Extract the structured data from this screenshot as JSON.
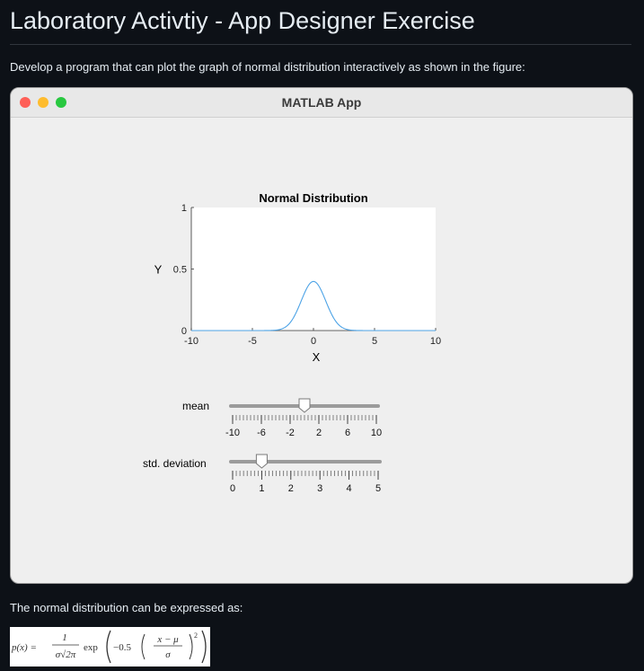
{
  "page": {
    "title": "Laboratory Activtiy - App Designer Exercise",
    "intro": "Develop a program that can plot the graph of normal distribution interactively as shown in the figure:",
    "formula_intro": "The normal distribution can be expressed as:"
  },
  "app": {
    "window_title": "MATLAB App",
    "colors": {
      "close": "#fe5f57",
      "minimize": "#febc2e",
      "maximize": "#28c840"
    }
  },
  "chart_data": {
    "type": "line",
    "title": "Normal Distribution",
    "xlabel": "X",
    "ylabel": "Y",
    "xlim": [
      -10,
      10
    ],
    "ylim": [
      0,
      1
    ],
    "x_ticks": [
      "-10",
      "-5",
      "0",
      "5",
      "10"
    ],
    "y_ticks": [
      "0",
      "0.5",
      "1"
    ],
    "series": [
      {
        "mu": 0,
        "sigma": 1,
        "color": "#4da3e6"
      }
    ]
  },
  "sliders": {
    "mean": {
      "label": "mean",
      "value": 0,
      "min": -10,
      "max": 10,
      "tick_labels": [
        "-10",
        "-6",
        "-2",
        "2",
        "6",
        "10"
      ]
    },
    "std": {
      "label": "std. deviation",
      "value": 1,
      "min": 0,
      "max": 5,
      "tick_labels": [
        "0",
        "1",
        "2",
        "3",
        "4",
        "5"
      ]
    }
  },
  "formula": {
    "lhs": "p(x) =",
    "numerator": "1",
    "denominator": "σ√2π",
    "func": "exp",
    "coef": "−0.5",
    "inner_numerator": "x − μ",
    "inner_denominator": "σ",
    "exponent": "2"
  }
}
